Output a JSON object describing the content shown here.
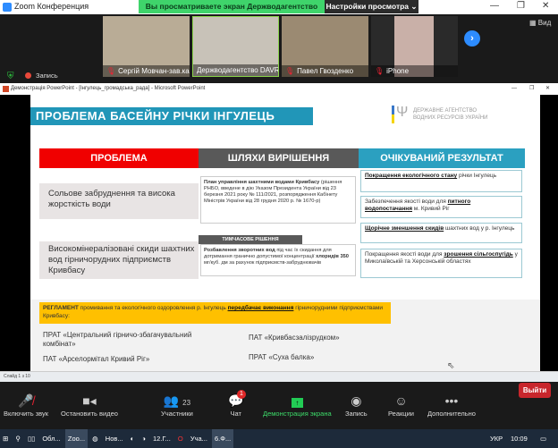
{
  "zoom": {
    "title": "Zoom Конференция",
    "banner": "Вы просматриваете экран Держводагентство DAVR",
    "view_options": "Настройки просмотра",
    "view_label": "Вид",
    "record_label": "Запись",
    "participants": [
      {
        "name": "Сергій Мовчан-зав.ка..."
      },
      {
        "name": "Держводагентство DAVR"
      },
      {
        "name": "Павел Гвозденко"
      },
      {
        "name": "iPhone"
      }
    ],
    "toolbar": {
      "audio": "Включить звук",
      "video": "Остановить видео",
      "participants": "Участники",
      "participants_count": "23",
      "chat": "Чат",
      "chat_badge": "1",
      "share": "Демонстрация экрана",
      "record": "Запись",
      "reactions": "Реакции",
      "more": "Дополнительно",
      "leave": "Выйти"
    }
  },
  "ppt": {
    "title": "Демонстрація PowerPoint - [Інгулець_громадська_рада] - Microsoft PowerPoint",
    "status": "Слайд 1 з 10"
  },
  "slide": {
    "title": "ПРОБЛЕМА БАСЕЙНУ РІЧКИ ІНГУЛЕЦЬ",
    "logo_line1": "ДЕРЖАВНЕ АГЕНТСТВО",
    "logo_line2": "ВОДНИХ РЕСУРСІВ УКРАЇНИ",
    "headers": [
      "ПРОБЛЕМА",
      "ШЛЯХИ ВИРІШЕННЯ",
      "ОЧІКУВАНИЙ РЕЗУЛЬТАТ"
    ],
    "problems": [
      "Сольове забруднення та висока жорсткість води",
      "Високомінералізовані скиди шахтних вод гірничорудних підприємств Кривбасу"
    ],
    "solution1_bold": "План управління шахтними водами Кривбасу",
    "solution1_text": " (рішення РНБО, введене в дію Указом Президента України від 23 березня 2021 року № 111/2021, розпорядження Кабінету Міністрів України від 28 грудня 2020 р. № 1670-р)",
    "temp_label": "ТИМЧАСОВЕ РІШЕННЯ",
    "solution2_bold": "Розбавлення зворотних вод",
    "solution2_text1": " під час їх скидання для дотримання гранично допустимої концентрації ",
    "solution2_bold2": "хлоридів 350",
    "solution2_text2": " мг/куб. дм за рахунок підприємств-забруднювачів",
    "results": [
      {
        "pre": "",
        "u": "Покращення екологічного стану",
        "post": " річки Інгулець"
      },
      {
        "pre": "Забезпечення якості води для ",
        "u": "питного водопостачання",
        "post": " м. Кривий Ріг"
      },
      {
        "pre": "",
        "u": "Щорічне зменшення скидів",
        "post": " шахтних вод у р. Інгулець"
      },
      {
        "pre": "Покращення якості води для ",
        "u": "зрошення сільгоспугідь",
        "post": " у Миколаївській та Херсонській областях"
      }
    ],
    "regl_bold": "РЕГЛАМЕНТ",
    "regl_text": " промивання та екологічного оздоровлення р. Інгулець ",
    "regl_u": "передбачає виконання",
    "regl_text2": " гірничорудними підприємствами Кривбасу:",
    "companies": [
      "ПРАТ «Центральний гірничо-збагачувальний комбінат»",
      "ПАТ «Кривбасзалізрудком»",
      "ПАТ «Арселормітал Кривий Ріг»",
      "ПРАТ «Суха балка»"
    ]
  },
  "taskbar": {
    "items": [
      "Обл...",
      "Zoo...",
      "Нов...",
      "12.Г...",
      "Уча...",
      "6.Ф..."
    ],
    "lang": "УКР",
    "time": "10:09"
  }
}
